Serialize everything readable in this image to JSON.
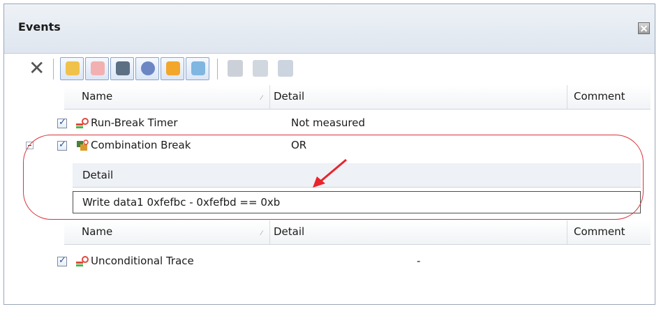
{
  "panel": {
    "title": "Events"
  },
  "toolbar": {
    "delete_icon": "delete-x-icon",
    "buttons": [
      "hardware-break-icon",
      "software-break-icon",
      "trace-icon",
      "timer-icon",
      "performance-icon",
      "output-icon"
    ],
    "disabled_buttons": [
      "edit-detail-icon",
      "copy-icon",
      "paste-icon"
    ]
  },
  "columns": {
    "name": "Name",
    "detail": "Detail",
    "comment": "Comment"
  },
  "rows": [
    {
      "name": "Run-Break Timer",
      "detail": "Not measured",
      "checked": true,
      "icon": "timer-event-icon"
    },
    {
      "name": "Combination Break",
      "detail": "OR",
      "checked": true,
      "icon": "combination-break-icon",
      "expanded": true
    }
  ],
  "sub_detail": {
    "header": "Detail",
    "value": "Write data1 0xfefbc - 0xfefbd == 0xb"
  },
  "rows2": [
    {
      "name": "Unconditional Trace",
      "detail": "-",
      "checked": true,
      "icon": "trace-event-icon"
    }
  ],
  "colors": {
    "highlight": "#d8343b",
    "arrow": "#e8242c",
    "accent": "#1f4fa0"
  }
}
